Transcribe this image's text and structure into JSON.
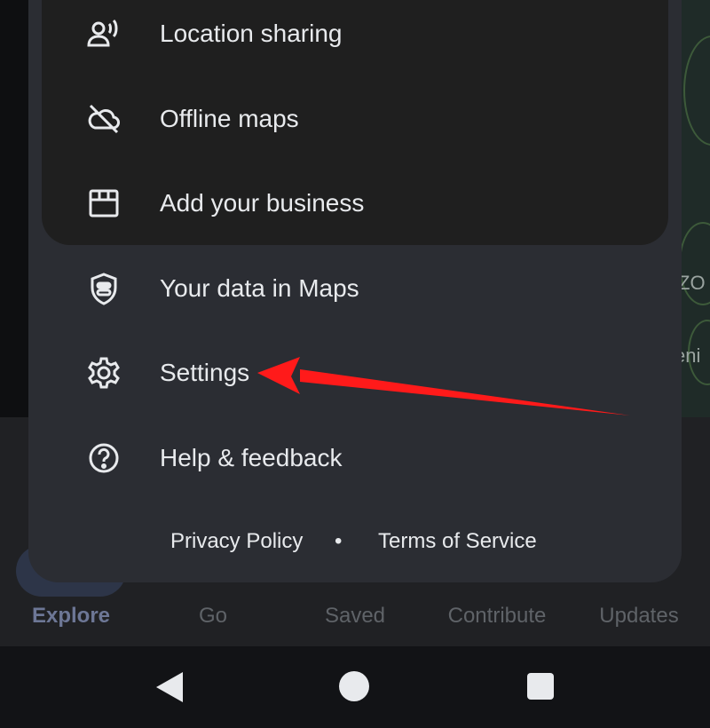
{
  "map": {
    "texts": [
      "ZO",
      "eni"
    ]
  },
  "menu": {
    "items": [
      {
        "label": "Location sharing",
        "icon": "location-sharing-icon"
      },
      {
        "label": "Offline maps",
        "icon": "offline-maps-icon"
      },
      {
        "label": "Add your business",
        "icon": "storefront-icon"
      },
      {
        "label": "Your data in Maps",
        "icon": "shield-icon"
      },
      {
        "label": "Settings",
        "icon": "gear-icon"
      },
      {
        "label": "Help & feedback",
        "icon": "help-icon"
      }
    ],
    "footer": {
      "privacy": "Privacy Policy",
      "separator": "•",
      "terms": "Terms of Service"
    }
  },
  "bottom_nav": {
    "items": [
      "Explore",
      "Go",
      "Saved",
      "Contribute",
      "Updates"
    ],
    "active": "Explore"
  },
  "annotation": {
    "arrow_color": "#ff1a1a"
  },
  "colors": {
    "sheet": "#2b2d33",
    "card": "#1f1f1f",
    "text": "#e8eaed"
  }
}
